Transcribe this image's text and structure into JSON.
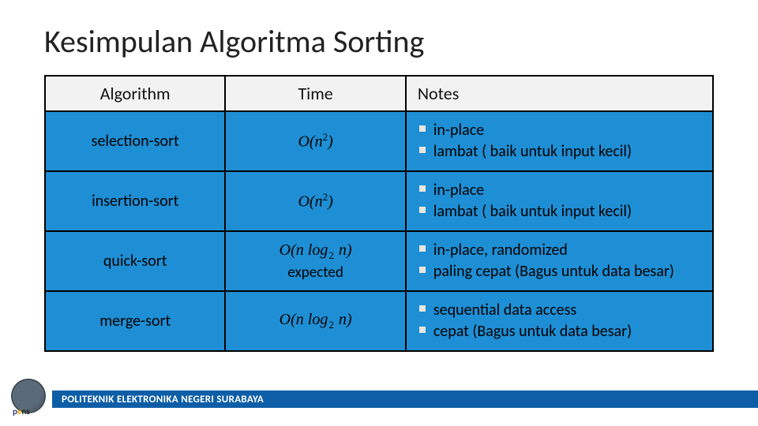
{
  "title": "Kesimpulan Algoritma Sorting",
  "headers": {
    "algorithm": "Algorithm",
    "time": "Time",
    "notes": "Notes"
  },
  "rows": [
    {
      "alg": "selection-sort",
      "time_html": "O(n^2)",
      "time_extra": "",
      "notes": [
        "in-place",
        "lambat ( baik untuk input kecil)"
      ]
    },
    {
      "alg": "insertion-sort",
      "time_html": "O(n^2)",
      "time_extra": "",
      "notes": [
        "in-place",
        "lambat ( baik untuk input kecil)"
      ]
    },
    {
      "alg": "quick-sort",
      "time_html": "O(n log2 n)",
      "time_extra": "expected",
      "notes": [
        "in-place, randomized",
        "paling cepat (Bagus untuk data besar)"
      ]
    },
    {
      "alg": "merge-sort",
      "time_html": "O(n log2 n)",
      "time_extra": "",
      "notes": [
        "sequential data access",
        "cepat  (Bagus untuk data besar)"
      ]
    }
  ],
  "footer": {
    "org": "POLITEKNIK ELEKTRONIKA NEGERI SURABAYA",
    "logo_text": "pens"
  },
  "chart_data": {
    "type": "table",
    "title": "Kesimpulan Algoritma Sorting",
    "columns": [
      "Algorithm",
      "Time",
      "Notes"
    ],
    "rows": [
      [
        "selection-sort",
        "O(n^2)",
        "in-place; lambat (baik untuk input kecil)"
      ],
      [
        "insertion-sort",
        "O(n^2)",
        "in-place; lambat (baik untuk input kecil)"
      ],
      [
        "quick-sort",
        "O(n log2 n) expected",
        "in-place, randomized; paling cepat (Bagus untuk data besar)"
      ],
      [
        "merge-sort",
        "O(n log2 n)",
        "sequential data access; cepat (Bagus untuk data besar)"
      ]
    ]
  }
}
